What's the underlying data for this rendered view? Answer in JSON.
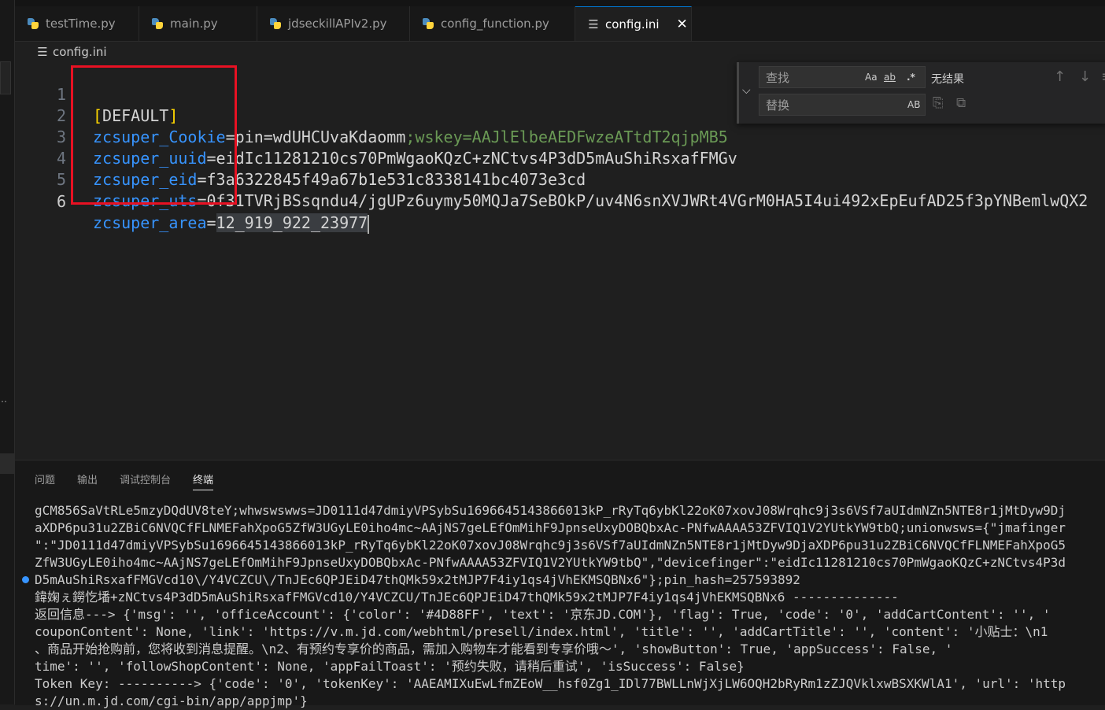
{
  "tabs": [
    {
      "label": "testTime.py",
      "icon": "python-icon",
      "active": false
    },
    {
      "label": "main.py",
      "icon": "python-icon",
      "active": false
    },
    {
      "label": "jdseckillAPIv2.py",
      "icon": "python-icon",
      "active": false
    },
    {
      "label": "config_function.py",
      "icon": "python-icon",
      "active": false
    },
    {
      "label": "config.ini",
      "icon": "ini-file-icon",
      "active": true
    }
  ],
  "close_glyph": "✕",
  "breadcrumb": {
    "file": "config.ini",
    "icon": "ini-file-icon"
  },
  "editor": {
    "lines": [
      {
        "num": "1",
        "section_open": "[",
        "section": "DEFAULT",
        "section_close": "]"
      },
      {
        "num": "2",
        "key": "zcsuper_Cookie",
        "eq": "=",
        "val": "pin=wdUHCUvaKdaomm",
        "semi": ";wskey=AAJlElbeAEDFwzeATtdT2qjpMB5"
      },
      {
        "num": "3",
        "key": "zcsuper_uuid",
        "eq": "=",
        "val": "eidIc11281210cs70PmWgaoKQzC+zNCtvs4P3dD5mAuShiRsxafFMGv"
      },
      {
        "num": "4",
        "key": "zcsuper_eid",
        "eq": "=",
        "val": "f3a6322845f49a67b1e531c8338141bc4073e3cd"
      },
      {
        "num": "5",
        "key": "zcsuper_uts",
        "eq": "=",
        "val": "0f31TVRjBSsqndu4/jgUPz6uymy50MQJa7SeBOkP/uv4N6snXVJWRt4VGrM0HA5I4ui492xEpEufAD25f3pYNBemlwQX2"
      },
      {
        "num": "6",
        "key": "zcsuper_area",
        "eq": "=",
        "val": "12_919_922_23977"
      }
    ]
  },
  "find_widget": {
    "find_placeholder": "查找",
    "replace_placeholder": "替换",
    "opt_case": "Aa",
    "opt_word": "ab",
    "opt_regex": ".*",
    "opt_preserve_case": "AB",
    "result": "无结果",
    "prev_glyph": "↑",
    "next_glyph": "↓",
    "toggle_glyph": "⌵"
  },
  "panel": {
    "tabs": [
      "问题",
      "输出",
      "调试控制台",
      "终端"
    ],
    "active_tab": "终端",
    "terminal_lines": [
      "gCM856SaVtRLe5mzyDQdUV8teY;whwswswws=JD0111d47dmiyVPSybSu1696645143866013kP_rRyTq6ybKl22oK07xovJ08Wrqhc9j3s6VSf7aUIdmNZn5NTE8r1jMtDyw9Dj",
      "aXDP6pu31u2ZBiC6NVQCfFLNMEFahXpoG5ZfW3UGyLE0iho4mc~AAjNS7geLEfOmMihF9JpnseUxyDOBQbxAc-PNfwAAAA53ZFVIQ1V2YUtkYW9tbQ;unionwsws={\"jmafinger",
      "\":\"JD0111d47dmiyVPSybSu1696645143866013kP_rRyTq6ybKl22oK07xovJ08Wrqhc9j3s6VSf7aUIdmNZn5NTE8r1jMtDyw9DjaXDP6pu31u2ZBiC6NVQCfFLNMEFahXpoG5",
      "ZfW3UGyLE0iho4mc~AAjNS7geLEfOmMihF9JpnseUxyDOBQbxAc-PNfwAAAA53ZFVIQ1V2YUtkYW9tbQ\",\"devicefinger\":\"eidIc11281210cs70PmWgaoKQzC+zNCtvs4P3d",
      "D5mAuShiRsxafFMGVcd10\\/Y4VCZCU\\/TnJEc6QPJEiD47thQMk59x2tMJP7F4iy1qs4jVhEKMSQBNx6\"};pin_hash=257593892",
      "鍏婅ぇ鐒忔墦+zNCtvs4P3dD5mAuShiRsxafFMGVcd10/Y4VCZCU/TnJEc6QPJEiD47thQMk59x2tMJP7F4iy1qs4jVhEKMSQBNx6 --------------",
      "返回信息---> {'msg': '', 'officeAccount': {'color': '#4D88FF', 'text': '京东JD.COM'}, 'flag': True, 'code': '0', 'addCartContent': '', '",
      "couponContent': None, 'link': 'https://v.m.jd.com/webhtml/presell/index.html', 'title': '', 'addCartTitle': '', 'content': '小贴士：\\n1",
      "、商品开始抢购前，您将收到消息提醒。\\n2、有预约专享价的商品，需加入购物车才能看到专享价哦～', 'showButton': True, 'appSuccess': False, '",
      "time': '', 'followShopContent': None, 'appFailToast': '预约失败，请稍后重试', 'isSuccess': False}",
      "Token Key: ----------> {'code': '0', 'tokenKey': 'AAEAMIXuEwLfmZEoW__hsf0Zg1_IDl77BWLLnWjXjLW6OQH2bRyRm1zZJQVklxwBSXKWlA1', 'url': 'http",
      "s://un.m.jd.com/cgi-bin/app/appjmp'}"
    ]
  },
  "colors": {
    "accent": "#0078d4",
    "highlight_box": "#e81123",
    "key": "#3794ff"
  }
}
